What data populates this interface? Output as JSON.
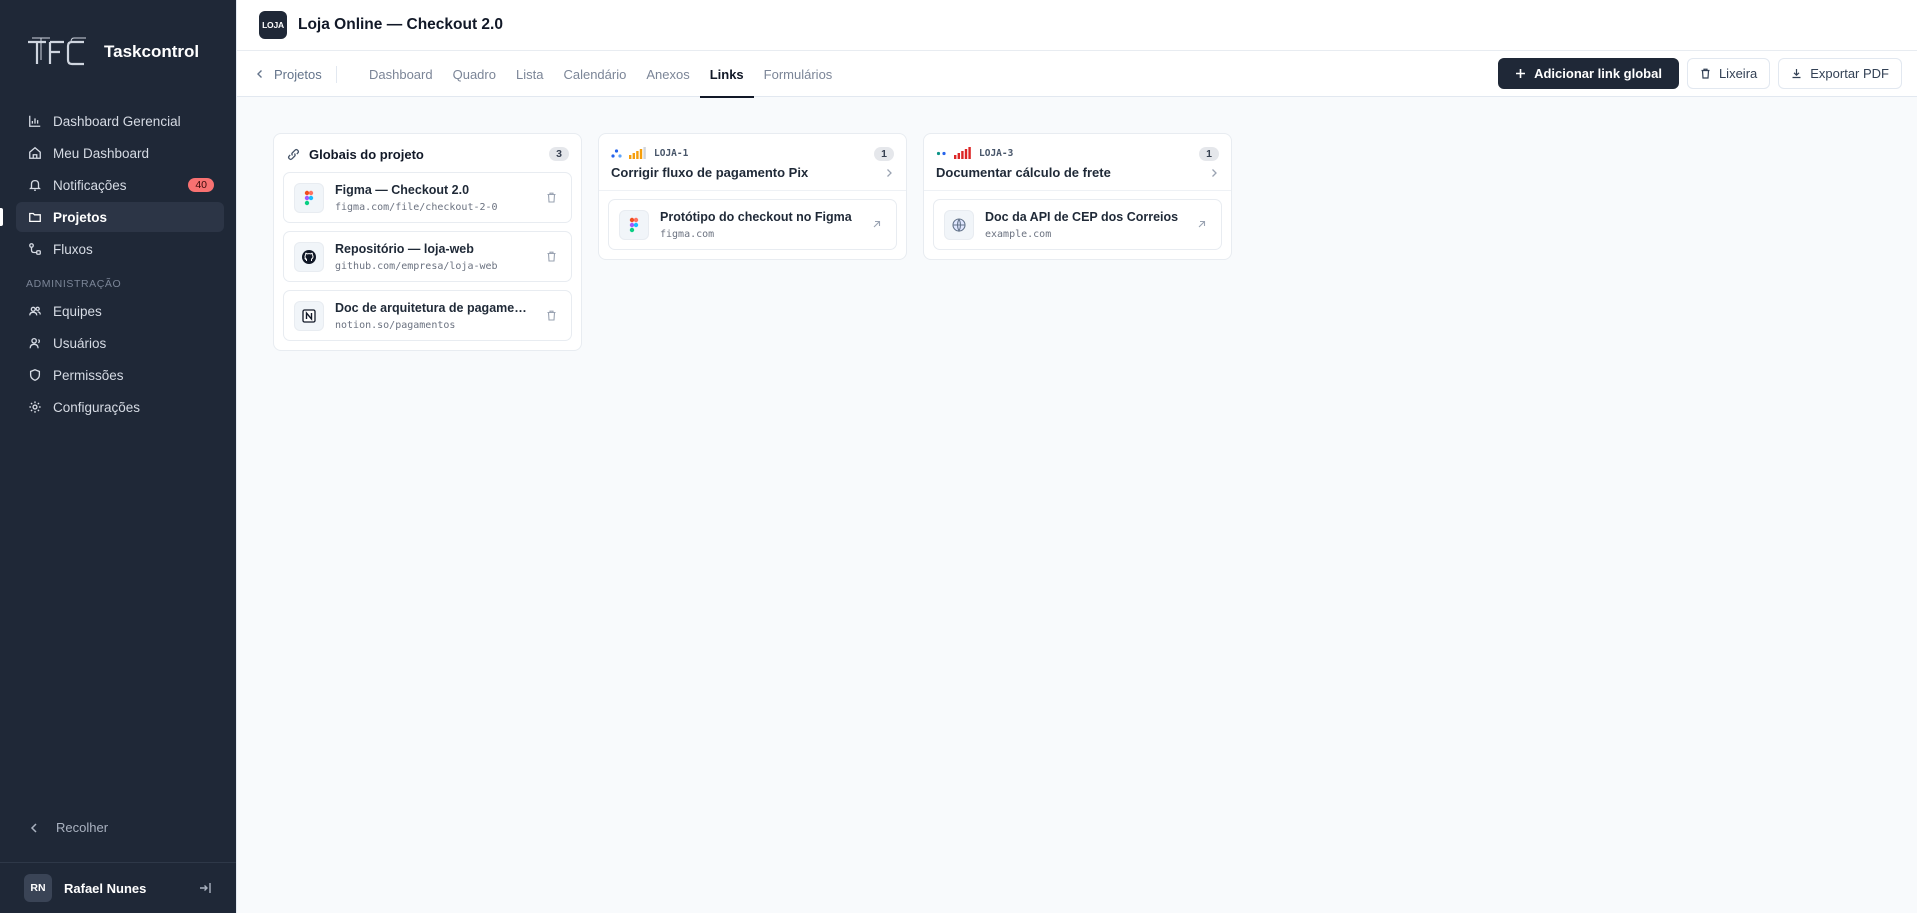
{
  "sidebar": {
    "brand_name": "Taskcontrol",
    "items": [
      {
        "label": "Dashboard Gerencial",
        "icon": "bar-chart-icon"
      },
      {
        "label": "Meu Dashboard",
        "icon": "home-icon"
      },
      {
        "label": "Notificações",
        "icon": "bell-icon",
        "badge": "40"
      },
      {
        "label": "Projetos",
        "icon": "folder-icon",
        "active": true
      },
      {
        "label": "Fluxos",
        "icon": "workflow-icon"
      }
    ],
    "admin_section_label": "ADMINISTRAÇÃO",
    "admin_items": [
      {
        "label": "Equipes",
        "icon": "team-icon"
      },
      {
        "label": "Usuários",
        "icon": "users-icon"
      },
      {
        "label": "Permissões",
        "icon": "shield-icon"
      },
      {
        "label": "Configurações",
        "icon": "gear-icon"
      }
    ],
    "collapse_label": "Recolher",
    "user": {
      "initials": "RN",
      "name": "Rafael Nunes"
    }
  },
  "header": {
    "project_logo": "LOJA",
    "project_title": "Loja Online — Checkout 2.0"
  },
  "tabbar": {
    "back_label": "Projetos",
    "tabs": [
      "Dashboard",
      "Quadro",
      "Lista",
      "Calendário",
      "Anexos",
      "Links",
      "Formulários"
    ],
    "active_tab": "Links",
    "actions": {
      "add_global_link": "Adicionar link global",
      "trash": "Lixeira",
      "export_pdf": "Exportar PDF"
    }
  },
  "columns": {
    "global": {
      "title": "Globais do projeto",
      "count": "3",
      "links": [
        {
          "title": "Figma — Checkout 2.0",
          "url": "figma.com/file/checkout-2-0",
          "icon": "figma-icon"
        },
        {
          "title": "Repositório — loja-web",
          "url": "github.com/empresa/loja-web",
          "icon": "github-icon"
        },
        {
          "title": "Doc de arquitetura de pagamentos",
          "url": "notion.so/pagamentos",
          "icon": "notion-icon"
        }
      ]
    },
    "issue1": {
      "key": "LOJA-1",
      "title": "Corrigir fluxo de pagamento Pix",
      "count": "1",
      "priority": "medium-high",
      "links": [
        {
          "title": "Protótipo do checkout no Figma",
          "url": "figma.com",
          "icon": "figma-icon"
        }
      ]
    },
    "issue3": {
      "key": "LOJA-3",
      "title": "Documentar cálculo de frete",
      "count": "1",
      "priority": "urgent",
      "links": [
        {
          "title": "Doc da API de CEP dos Correios",
          "url": "example.com",
          "icon": "globe-icon"
        }
      ]
    }
  },
  "colors": {
    "sidebar_bg": "#1f2837",
    "primary_button": "#1f2837",
    "badge_red": "#f87171",
    "priority_orange": "#f59e0b",
    "priority_red": "#dc2626"
  }
}
